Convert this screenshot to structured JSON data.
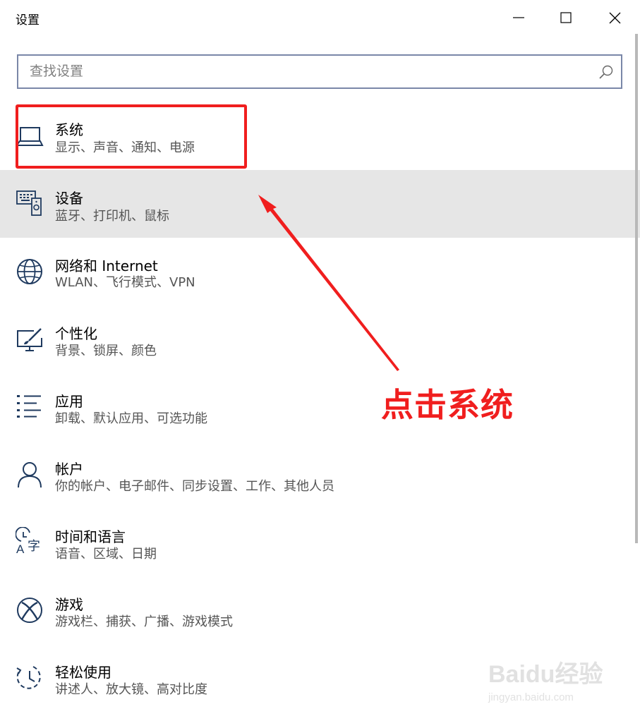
{
  "window": {
    "title": "设置",
    "minimize_icon": "minimize-icon",
    "maximize_icon": "maximize-icon",
    "close_icon": "close-icon"
  },
  "search": {
    "placeholder": "查找设置",
    "value": "",
    "icon": "search-icon"
  },
  "items": [
    {
      "title": "系统",
      "subtitle": "显示、声音、通知、电源",
      "icon": "laptop-icon"
    },
    {
      "title": "设备",
      "subtitle": "蓝牙、打印机、鼠标",
      "icon": "devices-icon"
    },
    {
      "title": "网络和 Internet",
      "subtitle": "WLAN、飞行模式、VPN",
      "icon": "globe-icon"
    },
    {
      "title": "个性化",
      "subtitle": "背景、锁屏、颜色",
      "icon": "personalize-icon"
    },
    {
      "title": "应用",
      "subtitle": "卸载、默认应用、可选功能",
      "icon": "apps-list-icon"
    },
    {
      "title": "帐户",
      "subtitle": "你的帐户、电子邮件、同步设置、工作、其他人员",
      "icon": "person-icon"
    },
    {
      "title": "时间和语言",
      "subtitle": "语音、区域、日期",
      "icon": "time-language-icon"
    },
    {
      "title": "游戏",
      "subtitle": "游戏栏、捕获、广播、游戏模式",
      "icon": "xbox-icon"
    },
    {
      "title": "轻松使用",
      "subtitle": "讲述人、放大镜、高对比度",
      "icon": "ease-of-access-icon"
    }
  ],
  "annotation": {
    "text": "点击系统",
    "color": "#f01e1e"
  },
  "watermark": {
    "text": "Baidu经验",
    "url": "jingyan.baidu.com"
  },
  "colors": {
    "hover_bg": "#e6e6e6",
    "search_border": "#7a87a8",
    "icon_color": "#1f3a5f"
  }
}
